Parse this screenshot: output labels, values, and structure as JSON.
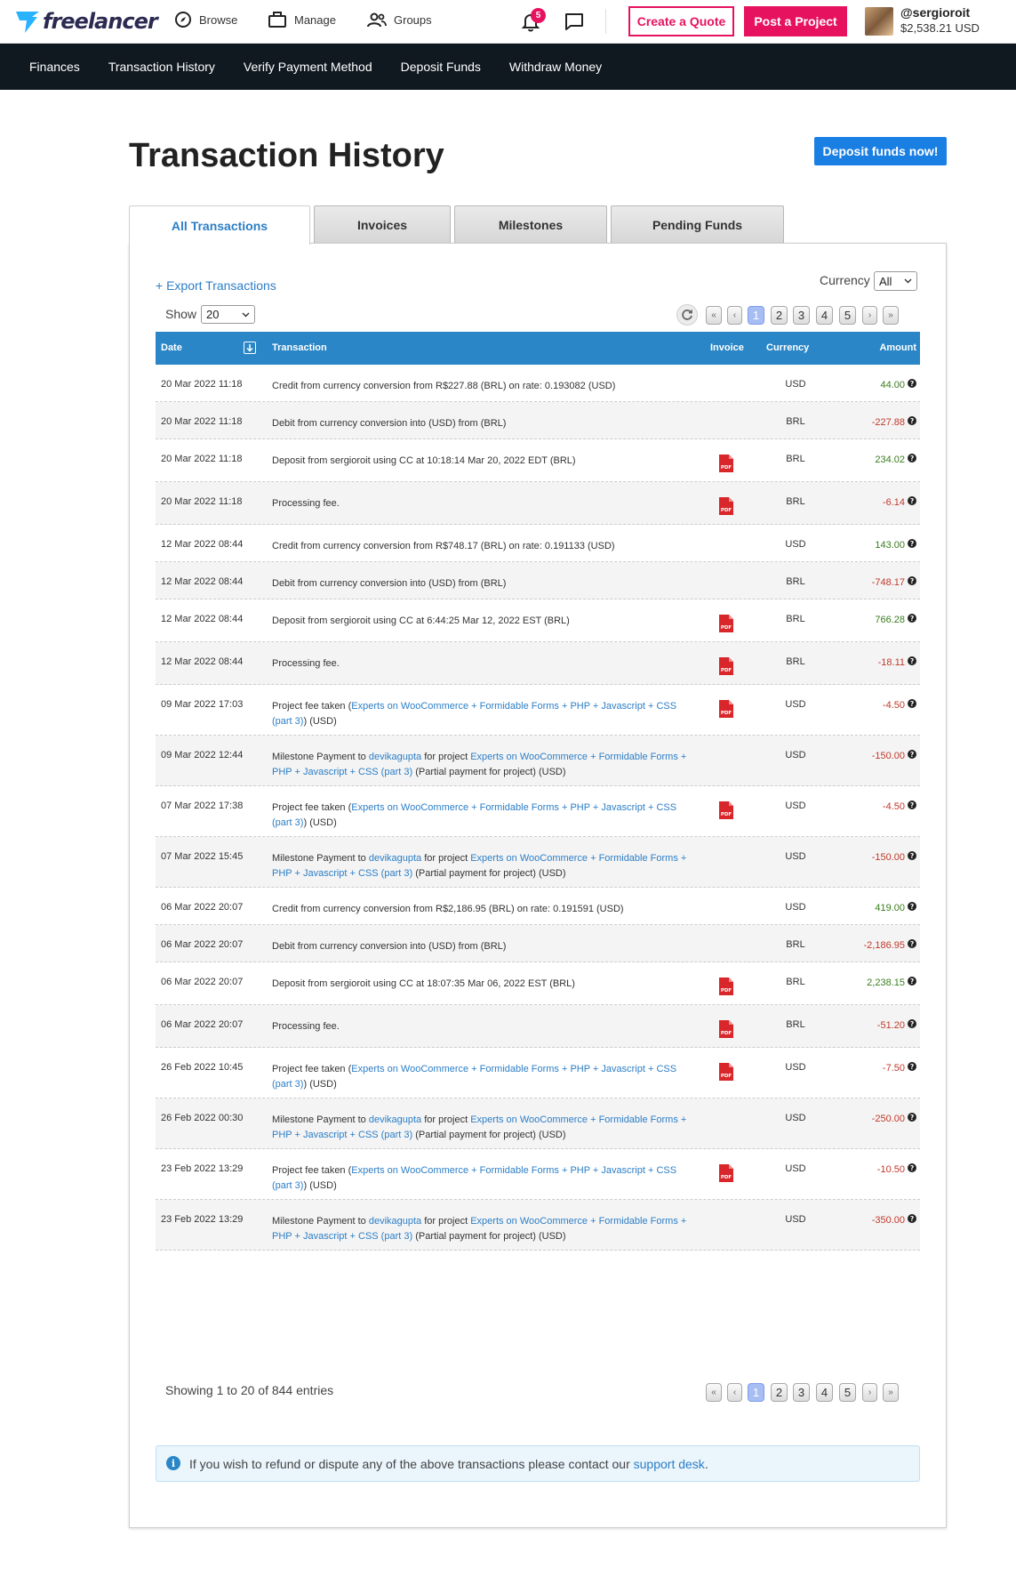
{
  "header": {
    "logo_text": "freelancer",
    "nav": {
      "browse": "Browse",
      "manage": "Manage",
      "groups": "Groups"
    },
    "notification_count": "5",
    "create_quote": "Create a Quote",
    "post_project": "Post a Project",
    "username": "@sergioroit",
    "balance": "$2,538.21 USD"
  },
  "subnav": [
    "Finances",
    "Transaction History",
    "Verify Payment Method",
    "Deposit Funds",
    "Withdraw Money"
  ],
  "page": {
    "title": "Transaction History",
    "deposit_button": "Deposit funds now!",
    "tabs": [
      "All Transactions",
      "Invoices",
      "Milestones",
      "Pending Funds"
    ],
    "export_link": "+ Export Transactions",
    "currency_label": "Currency",
    "currency_value": "All",
    "show_label": "Show",
    "show_value": "20",
    "pagination": [
      "«",
      "‹",
      "1",
      "2",
      "3",
      "4",
      "5",
      "›",
      "»"
    ],
    "current_page": "1",
    "columns": {
      "date": "Date",
      "transaction": "Transaction",
      "invoice": "Invoice",
      "currency": "Currency",
      "amount": "Amount"
    },
    "showing": "Showing 1 to 20 of 844 entries",
    "notice_text": "If you wish to refund or dispute any of the above transactions please contact our ",
    "notice_link": "support desk",
    "notice_end": "."
  },
  "rows": [
    {
      "date": "20 Mar 2022 11:18",
      "parts": [
        [
          "Credit from currency conversion from R$227.88 (BRL) on rate: 0.193082 (USD)",
          0
        ]
      ],
      "pdf": false,
      "currency": "USD",
      "amount": "44.00",
      "sign": "pos"
    },
    {
      "date": "20 Mar 2022 11:18",
      "parts": [
        [
          "Debit from currency conversion into (USD) from (BRL)",
          0
        ]
      ],
      "pdf": false,
      "currency": "BRL",
      "amount": "-227.88",
      "sign": "neg"
    },
    {
      "date": "20 Mar 2022 11:18",
      "parts": [
        [
          "Deposit from sergioroit using CC at 10:18:14 Mar 20, 2022 EDT (BRL)",
          0
        ]
      ],
      "pdf": true,
      "currency": "BRL",
      "amount": "234.02",
      "sign": "pos"
    },
    {
      "date": "20 Mar 2022 11:18",
      "parts": [
        [
          "Processing fee.",
          0
        ]
      ],
      "pdf": true,
      "currency": "BRL",
      "amount": "-6.14",
      "sign": "neg"
    },
    {
      "date": "12 Mar 2022 08:44",
      "parts": [
        [
          "Credit from currency conversion from R$748.17 (BRL) on rate: 0.191133 (USD)",
          0
        ]
      ],
      "pdf": false,
      "currency": "USD",
      "amount": "143.00",
      "sign": "pos"
    },
    {
      "date": "12 Mar 2022 08:44",
      "parts": [
        [
          "Debit from currency conversion into (USD) from (BRL)",
          0
        ]
      ],
      "pdf": false,
      "currency": "BRL",
      "amount": "-748.17",
      "sign": "neg"
    },
    {
      "date": "12 Mar 2022 08:44",
      "parts": [
        [
          "Deposit from sergioroit using CC at 6:44:25 Mar 12, 2022 EST (BRL)",
          0
        ]
      ],
      "pdf": true,
      "currency": "BRL",
      "amount": "766.28",
      "sign": "pos"
    },
    {
      "date": "12 Mar 2022 08:44",
      "parts": [
        [
          "Processing fee.",
          0
        ]
      ],
      "pdf": true,
      "currency": "BRL",
      "amount": "-18.11",
      "sign": "neg"
    },
    {
      "date": "09 Mar 2022 17:03",
      "parts": [
        [
          "Project fee taken (",
          0
        ],
        [
          "Experts on WooCommerce + Formidable Forms + PHP + Javascript + CSS (part 3)",
          1
        ],
        [
          ") (USD)",
          0
        ]
      ],
      "pdf": true,
      "currency": "USD",
      "amount": "-4.50",
      "sign": "neg"
    },
    {
      "date": "09 Mar 2022 12:44",
      "parts": [
        [
          "Milestone Payment to ",
          0
        ],
        [
          "devikagupta",
          1
        ],
        [
          " for project ",
          0
        ],
        [
          "Experts on WooCommerce + Formidable Forms + PHP + Javascript + CSS (part 3)",
          1
        ],
        [
          " (Partial payment for project) (USD)",
          0
        ]
      ],
      "pdf": false,
      "currency": "USD",
      "amount": "-150.00",
      "sign": "neg"
    },
    {
      "date": "07 Mar 2022 17:38",
      "parts": [
        [
          "Project fee taken (",
          0
        ],
        [
          "Experts on WooCommerce + Formidable Forms + PHP + Javascript + CSS (part 3)",
          1
        ],
        [
          ") (USD)",
          0
        ]
      ],
      "pdf": true,
      "currency": "USD",
      "amount": "-4.50",
      "sign": "neg"
    },
    {
      "date": "07 Mar 2022 15:45",
      "parts": [
        [
          "Milestone Payment to ",
          0
        ],
        [
          "devikagupta",
          1
        ],
        [
          " for project ",
          0
        ],
        [
          "Experts on WooCommerce + Formidable Forms + PHP + Javascript + CSS (part 3)",
          1
        ],
        [
          " (Partial payment for project) (USD)",
          0
        ]
      ],
      "pdf": false,
      "currency": "USD",
      "amount": "-150.00",
      "sign": "neg"
    },
    {
      "date": "06 Mar 2022 20:07",
      "parts": [
        [
          "Credit from currency conversion from R$2,186.95 (BRL) on rate: 0.191591 (USD)",
          0
        ]
      ],
      "pdf": false,
      "currency": "USD",
      "amount": "419.00",
      "sign": "pos"
    },
    {
      "date": "06 Mar 2022 20:07",
      "parts": [
        [
          "Debit from currency conversion into (USD) from (BRL)",
          0
        ]
      ],
      "pdf": false,
      "currency": "BRL",
      "amount": "-2,186.95",
      "sign": "neg"
    },
    {
      "date": "06 Mar 2022 20:07",
      "parts": [
        [
          "Deposit from sergioroit using CC at 18:07:35 Mar 06, 2022 EST (BRL)",
          0
        ]
      ],
      "pdf": true,
      "currency": "BRL",
      "amount": "2,238.15",
      "sign": "pos"
    },
    {
      "date": "06 Mar 2022 20:07",
      "parts": [
        [
          "Processing fee.",
          0
        ]
      ],
      "pdf": true,
      "currency": "BRL",
      "amount": "-51.20",
      "sign": "neg"
    },
    {
      "date": "26 Feb 2022 10:45",
      "parts": [
        [
          "Project fee taken (",
          0
        ],
        [
          "Experts on WooCommerce + Formidable Forms + PHP + Javascript + CSS (part 3)",
          1
        ],
        [
          ") (USD)",
          0
        ]
      ],
      "pdf": true,
      "currency": "USD",
      "amount": "-7.50",
      "sign": "neg"
    },
    {
      "date": "26 Feb 2022 00:30",
      "parts": [
        [
          "Milestone Payment to ",
          0
        ],
        [
          "devikagupta",
          1
        ],
        [
          " for project ",
          0
        ],
        [
          "Experts on WooCommerce + Formidable Forms + PHP + Javascript + CSS (part 3)",
          1
        ],
        [
          " (Partial payment for project) (USD)",
          0
        ]
      ],
      "pdf": false,
      "currency": "USD",
      "amount": "-250.00",
      "sign": "neg"
    },
    {
      "date": "23 Feb 2022 13:29",
      "parts": [
        [
          "Project fee taken (",
          0
        ],
        [
          "Experts on WooCommerce + Formidable Forms + PHP + Javascript + CSS (part 3)",
          1
        ],
        [
          ") (USD)",
          0
        ]
      ],
      "pdf": true,
      "currency": "USD",
      "amount": "-10.50",
      "sign": "neg"
    },
    {
      "date": "23 Feb 2022 13:29",
      "parts": [
        [
          "Milestone Payment to ",
          0
        ],
        [
          "devikagupta",
          1
        ],
        [
          " for project ",
          0
        ],
        [
          "Experts on WooCommerce + Formidable Forms + PHP + Javascript + CSS (part 3)",
          1
        ],
        [
          " (Partial payment for project) (USD)",
          0
        ]
      ],
      "pdf": false,
      "currency": "USD",
      "amount": "-350.00",
      "sign": "neg"
    }
  ],
  "colors": {
    "brand_pink": "#e6125f",
    "accent_blue": "#2a86c6",
    "positive": "#3a7d1e",
    "negative": "#c0392b"
  }
}
